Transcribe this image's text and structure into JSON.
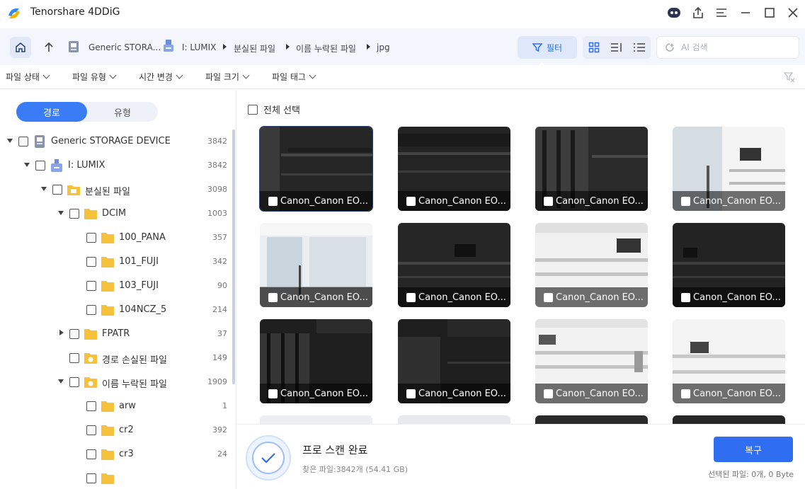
{
  "app": {
    "title": "Tenorshare 4DDiG"
  },
  "nav": {
    "breadcrumbs": [
      "Generic STORA...",
      "I: LUMIX",
      "분실된 파일",
      "이름 누락된 파일",
      "jpg"
    ],
    "filter_label": "필터",
    "search_placeholder": "AI 검색"
  },
  "filters": [
    "파일 상태",
    "파일 유형",
    "시간 변경",
    "파일 크기",
    "파일 태그"
  ],
  "sidebar": {
    "tabs": [
      "경로",
      "유형"
    ],
    "tree": [
      {
        "label": "Generic STORAGE DEVICE",
        "count": "3842"
      },
      {
        "label": "I: LUMIX",
        "count": "3842"
      },
      {
        "label": "분실된 파일",
        "count": "3098"
      },
      {
        "label": "DCIM",
        "count": "1003"
      },
      {
        "label": "100_PANA",
        "count": "357"
      },
      {
        "label": "101_FUJI",
        "count": "342"
      },
      {
        "label": "103_FUJI",
        "count": "90"
      },
      {
        "label": "104NCZ_5",
        "count": "214"
      },
      {
        "label": "FPATR",
        "count": "37"
      },
      {
        "label": "경로 손실된 파일",
        "count": "149"
      },
      {
        "label": "이름 누락된 파일",
        "count": "1909"
      },
      {
        "label": "arw",
        "count": "1"
      },
      {
        "label": "cr2",
        "count": "392"
      },
      {
        "label": "cr3",
        "count": "24"
      }
    ]
  },
  "main": {
    "select_all": "전체 선택",
    "thumb_caption": "Canon_Canon EO..."
  },
  "bottom": {
    "scan_title": "프로 스캔 완료",
    "found": "찾은 파일:3842개 (54.41 GB)",
    "recover": "복구",
    "selected": "선택된 파일: 0개, 0 Byte"
  },
  "colors": {
    "accent": "#2f6ef0",
    "folder": "#f7c23b"
  }
}
